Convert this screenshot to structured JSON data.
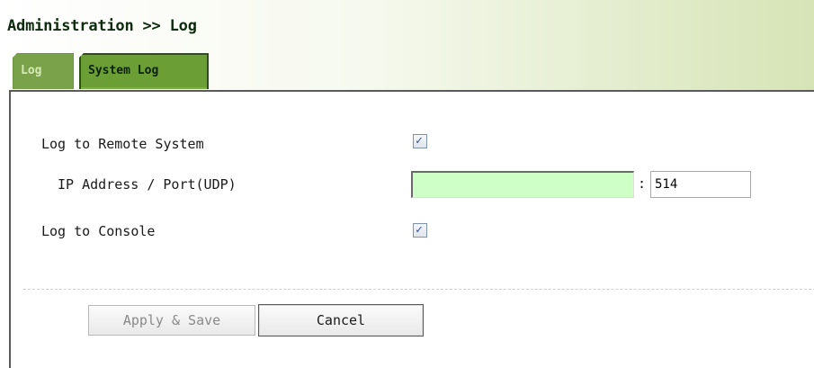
{
  "header": {
    "title": "Administration >> Log"
  },
  "tabs": [
    {
      "label": "Log",
      "active": false
    },
    {
      "label": "System Log",
      "active": true
    }
  ],
  "form": {
    "log_remote_label": "Log to Remote System",
    "log_remote_checked": true,
    "ip_port_label": "IP Address / Port(UDP)",
    "ip_value": "",
    "port_separator": ":",
    "port_value": "514",
    "log_console_label": "Log to Console",
    "log_console_checked": true,
    "checkbox_glyph": "✓"
  },
  "buttons": {
    "apply_label": "Apply & Save",
    "cancel_label": "Cancel"
  },
  "colors": {
    "accent_green": "#6b9f35",
    "input_highlight": "#cdffc6"
  }
}
